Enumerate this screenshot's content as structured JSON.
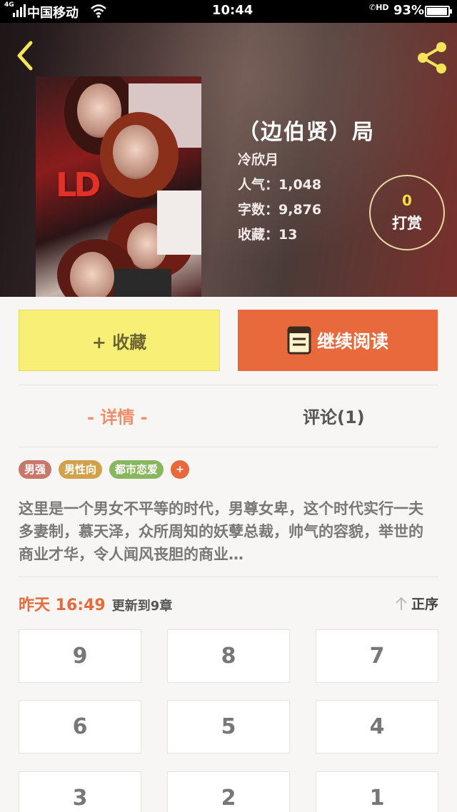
{
  "status_bar": {
    "network": "4G",
    "carrier": "中国移动",
    "time": "10:44",
    "call_indicator": "HD",
    "battery": "93%"
  },
  "header": {
    "back_icon": "back-chevron-icon",
    "share_icon": "share-icon"
  },
  "book": {
    "title": "（边伯贤）局",
    "author": "冷欣月",
    "popularity": "人气：1,048",
    "word_count": "字数：9,876",
    "favorites": "收藏：13",
    "cover_logo": "LD"
  },
  "tip": {
    "count": "0",
    "label": "打赏"
  },
  "actions": {
    "collect_label": "+ 收藏",
    "read_label": "继续阅读"
  },
  "tabs": [
    {
      "label": "- 详情 -",
      "active": true
    },
    {
      "label": "评论(1)",
      "active": false
    }
  ],
  "tags": [
    {
      "label": "男强",
      "color": "#c9776a"
    },
    {
      "label": "男性向",
      "color": "#d1a14b"
    },
    {
      "label": "都市恋爱",
      "color": "#88b75f"
    },
    {
      "label": "+",
      "color": "#e8693c"
    }
  ],
  "synopsis": "这里是一个男女不平等的时代，男尊女卑，这个时代实行一夫多妻制，慕天泽，众所周知的妖孽总裁，帅气的容貌，举世的商业才华，令人闻风丧胆的商业…",
  "update": {
    "when": "昨天 16:49",
    "text": "更新到9章",
    "sort_label": "正序"
  },
  "chapters": [
    "9",
    "8",
    "7",
    "6",
    "5",
    "4",
    "3",
    "2",
    "1"
  ],
  "colors": {
    "accent_orange": "#e8693c",
    "collect_yellow": "#f8ef76",
    "tab_active": "#f28e67"
  }
}
